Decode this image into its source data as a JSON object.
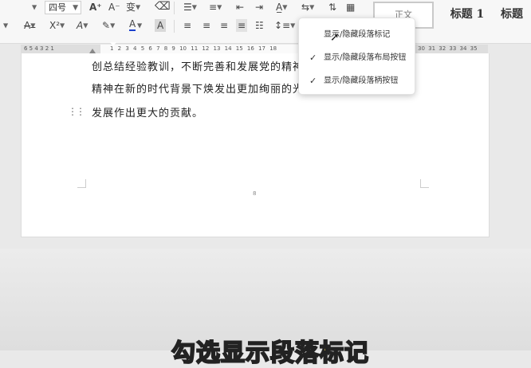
{
  "toolbar": {
    "font_size": "四号",
    "style_normal": "正文",
    "style_heading1": "标题 1",
    "style_heading": "标题"
  },
  "ruler": {
    "left_numbers": "6 5 4 3 2 1",
    "main_numbers": "1 2 3 4 5 6 7 8 9 10 11 12 13 14 15 16 17 18",
    "right_numbers": "30 31 32 33 34 35"
  },
  "document": {
    "line1": "创总结经验教训，不断完善和发展党的精神",
    "line2": "精神在新的时代背景下焕发出更加绚丽的光",
    "line3": "发展作出更大的贡献。",
    "page_number": "8"
  },
  "dropdown": {
    "items": [
      {
        "label": "显示/隐藏段落标记",
        "checked": false
      },
      {
        "label": "显示/隐藏段落布局按钮",
        "checked": true
      },
      {
        "label": "显示/隐藏段落柄按钮",
        "checked": true
      }
    ]
  },
  "subtitle": "勾选显示段落标记",
  "icons": [
    "chevron-down-icon",
    "increase-font-icon",
    "decrease-font-icon",
    "pinyin-icon",
    "eraser-icon",
    "bullet-list-icon",
    "numbered-list-icon",
    "decrease-indent-icon",
    "increase-indent-icon",
    "chinese-layout-icon",
    "text-direction-icon",
    "sort-icon",
    "table-icon",
    "strikethrough-icon",
    "superscript-icon",
    "text-effect-icon",
    "highlight-icon",
    "font-color-icon",
    "char-shading-icon",
    "align-left-icon",
    "align-center-icon",
    "align-right-icon",
    "justify-icon",
    "distributed-icon",
    "line-spacing-icon",
    "paragraph-mark-icon",
    "drag-handle-icon",
    "mouse-cursor-icon",
    "check-icon"
  ]
}
